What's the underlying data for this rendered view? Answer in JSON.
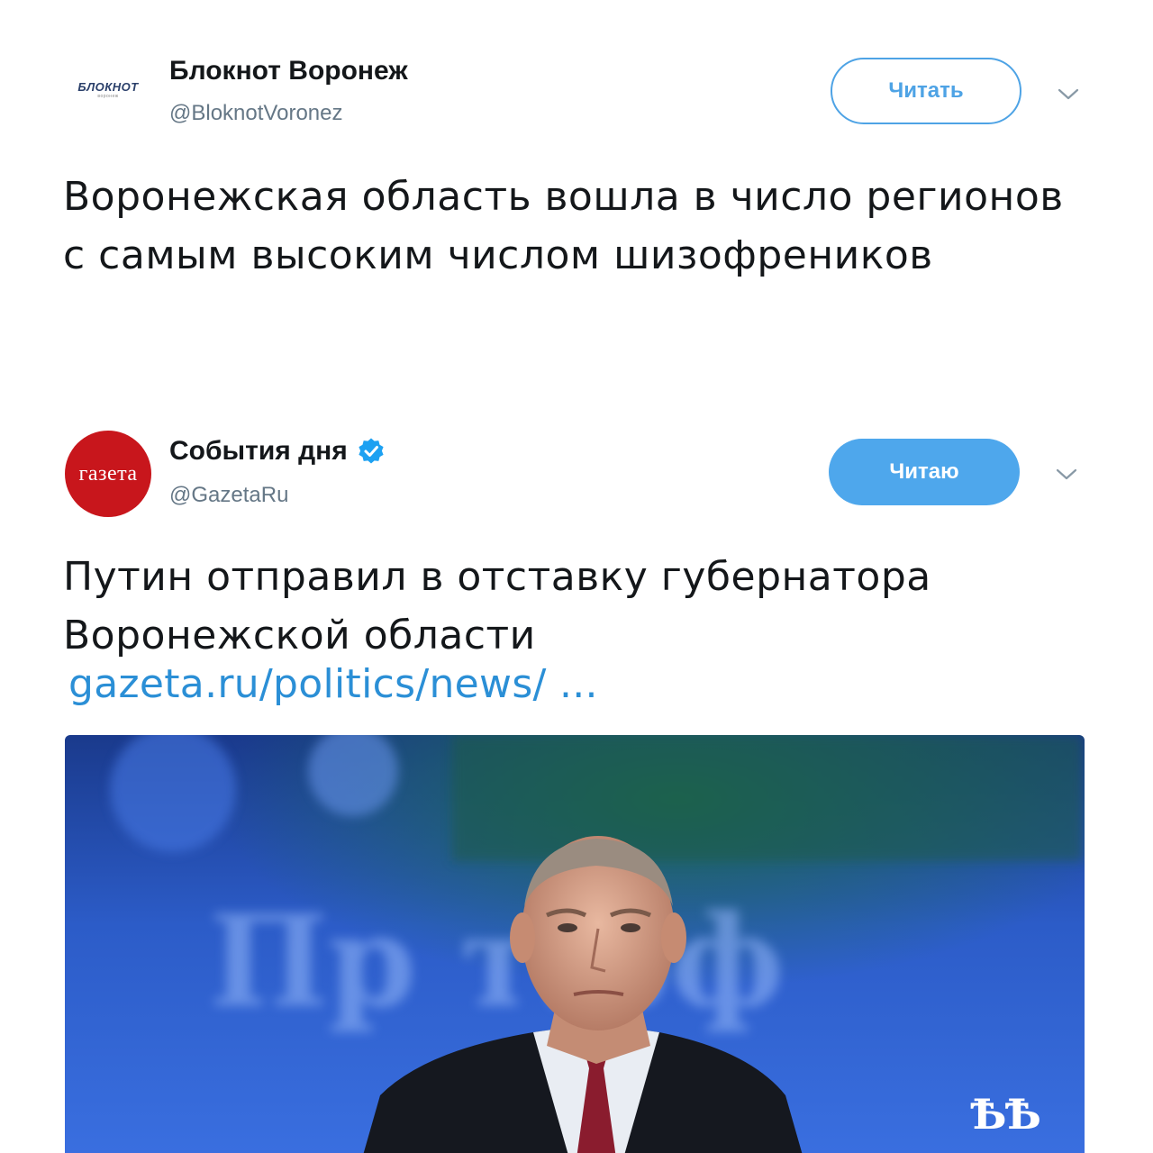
{
  "tweets": [
    {
      "avatar": {
        "brand_text": "БЛОКНОТ",
        "brand_sub": "воронеж"
      },
      "display_name": "Блокнот Воронеж",
      "verified": false,
      "handle": "@BloknotVoronez",
      "follow_button": {
        "label": "Читать",
        "state": "outline"
      },
      "text": "Воронежская область вошла в число регионов с самым высоким числом шизофреников"
    },
    {
      "avatar": {
        "brand_text": "газета"
      },
      "display_name": "События дня",
      "verified": true,
      "handle": "@GazetaRu",
      "follow_button": {
        "label": "Читаю",
        "state": "filled"
      },
      "text": "Путин отправил в отставку губернатора Воронежской области",
      "link": "gazeta.ru/politics/news/ ...",
      "media": {
        "background_text": "Пр          т.рф"
      }
    }
  ],
  "watermark": "ѢѢ",
  "colors": {
    "accent": "#4ea7ec",
    "link": "#2b8fd6",
    "gazeta_red": "#c8161c",
    "muted": "#657786"
  },
  "icons": {
    "verified": "verified-badge-icon",
    "more": "chevron-down-icon"
  }
}
